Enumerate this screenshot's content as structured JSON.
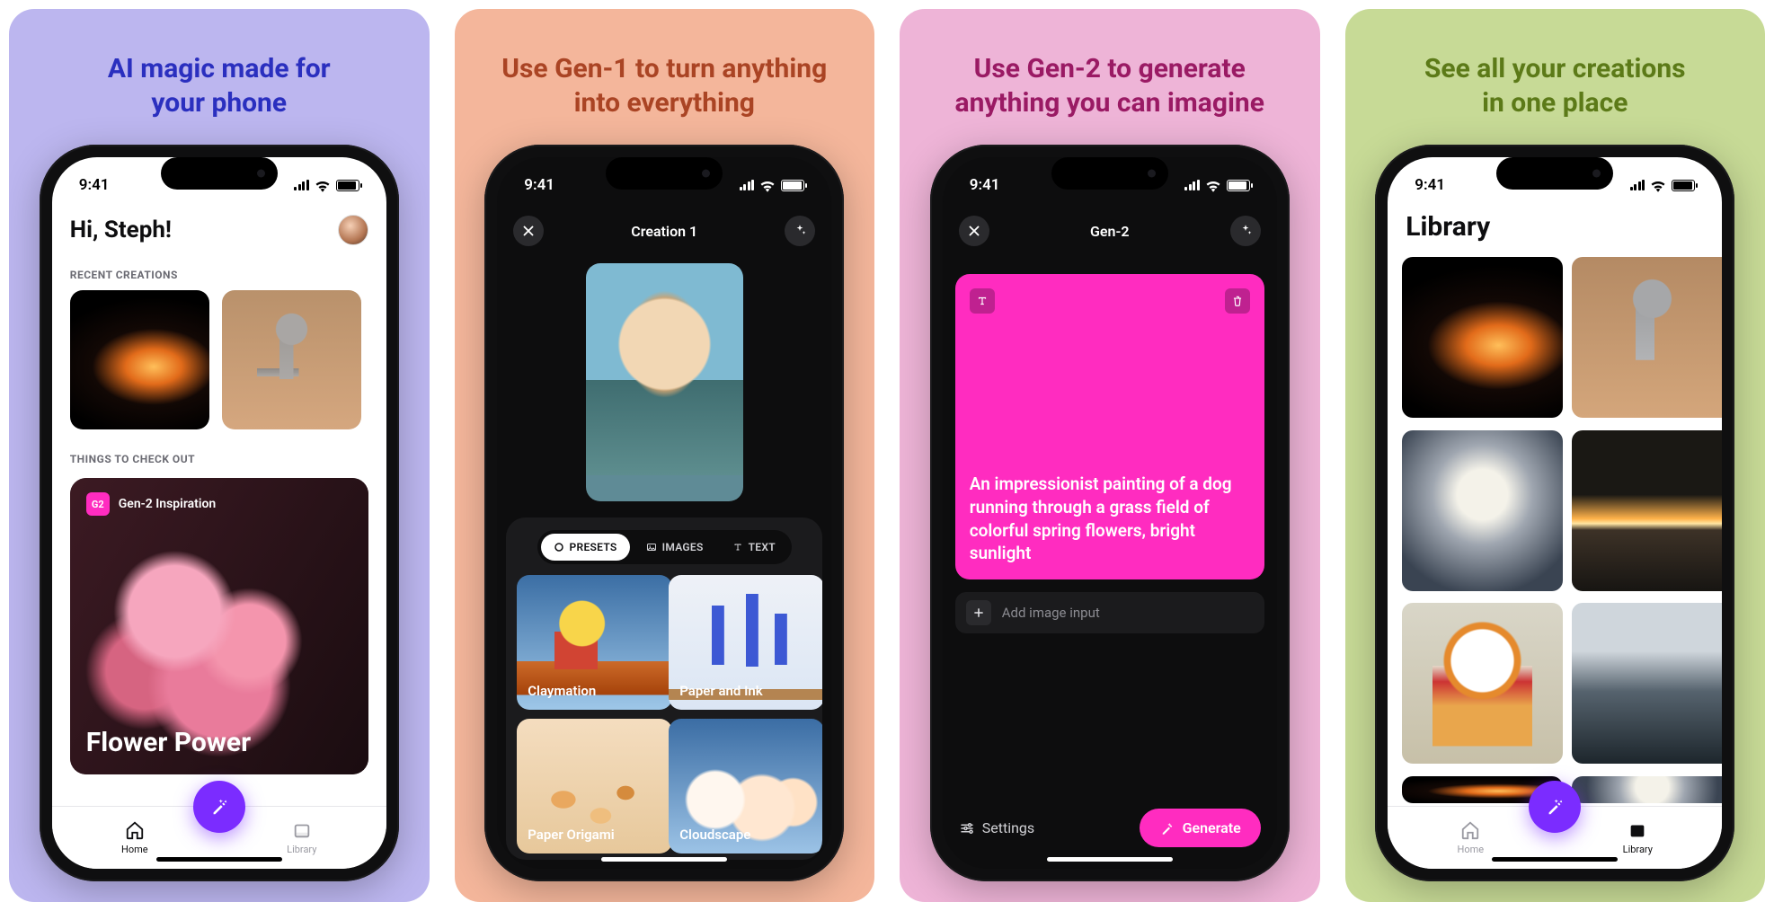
{
  "status_time": "9:41",
  "panels": {
    "p1": {
      "headline": "AI magic made for\nyour phone"
    },
    "p2": {
      "headline": "Use Gen-1 to turn anything\ninto everything"
    },
    "p3": {
      "headline": "Use Gen-2 to generate\nanything you can imagine"
    },
    "p4": {
      "headline": "See all your creations\nin one place"
    }
  },
  "home": {
    "greeting": "Hi, Steph!",
    "section_recent": "RECENT CREATIONS",
    "section_checkout": "THINGS TO CHECK OUT",
    "g2_badge": "G2",
    "g2_label": "Gen-2 Inspiration",
    "card_title": "Flower Power",
    "tab_home": "Home",
    "tab_library": "Library"
  },
  "creation": {
    "title": "Creation 1",
    "seg_presets": "PRESETS",
    "seg_images": "IMAGES",
    "seg_text": "TEXT",
    "presets": {
      "claymation": "Claymation",
      "paper_ink": "Paper and Ink",
      "origami": "Paper Origami",
      "cloudscape": "Cloudscape"
    }
  },
  "gen2": {
    "title": "Gen-2",
    "prompt": "An impressionist painting of a dog running through a grass field of colorful spring flowers, bright sunlight",
    "add_image": "Add image input",
    "settings": "Settings",
    "generate": "Generate"
  },
  "library": {
    "title": "Library",
    "tab_home": "Home",
    "tab_library": "Library"
  }
}
